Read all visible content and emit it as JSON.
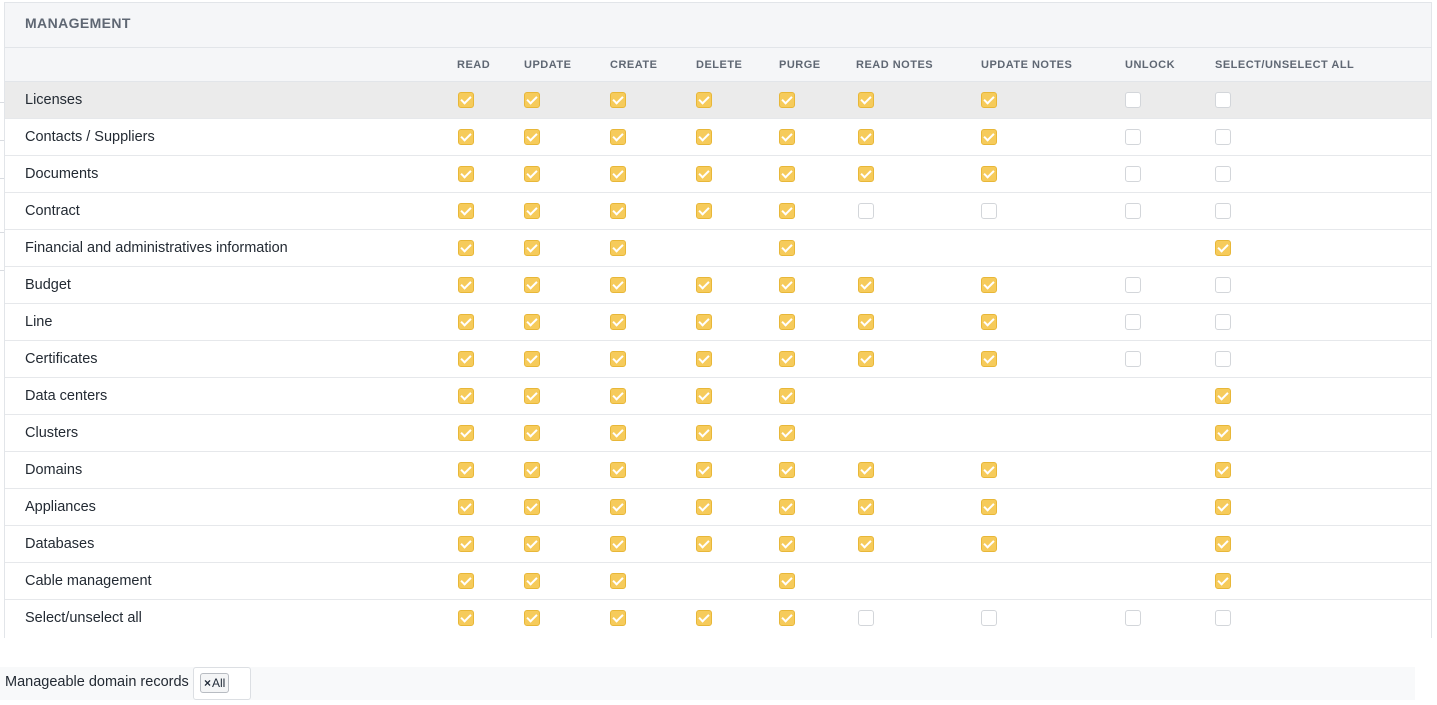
{
  "section_title": "MANAGEMENT",
  "columns": [
    "READ",
    "UPDATE",
    "CREATE",
    "DELETE",
    "PURGE",
    "READ NOTES",
    "UPDATE NOTES",
    "UNLOCK",
    "SELECT/UNSELECT ALL"
  ],
  "rows": [
    {
      "label": "Licenses",
      "cells": [
        1,
        1,
        1,
        1,
        1,
        1,
        1,
        0,
        0
      ]
    },
    {
      "label": "Contacts / Suppliers",
      "cells": [
        1,
        1,
        1,
        1,
        1,
        1,
        1,
        0,
        0
      ]
    },
    {
      "label": "Documents",
      "cells": [
        1,
        1,
        1,
        1,
        1,
        1,
        1,
        0,
        0
      ]
    },
    {
      "label": "Contract",
      "cells": [
        1,
        1,
        1,
        1,
        1,
        0,
        0,
        0,
        0
      ]
    },
    {
      "label": "Financial and administratives information",
      "cells": [
        1,
        1,
        1,
        null,
        1,
        null,
        null,
        null,
        1
      ]
    },
    {
      "label": "Budget",
      "cells": [
        1,
        1,
        1,
        1,
        1,
        1,
        1,
        0,
        0
      ]
    },
    {
      "label": "Line",
      "cells": [
        1,
        1,
        1,
        1,
        1,
        1,
        1,
        0,
        0
      ]
    },
    {
      "label": "Certificates",
      "cells": [
        1,
        1,
        1,
        1,
        1,
        1,
        1,
        0,
        0
      ]
    },
    {
      "label": "Data centers",
      "cells": [
        1,
        1,
        1,
        1,
        1,
        null,
        null,
        null,
        1
      ]
    },
    {
      "label": "Clusters",
      "cells": [
        1,
        1,
        1,
        1,
        1,
        null,
        null,
        null,
        1
      ]
    },
    {
      "label": "Domains",
      "cells": [
        1,
        1,
        1,
        1,
        1,
        1,
        1,
        null,
        1
      ]
    },
    {
      "label": "Appliances",
      "cells": [
        1,
        1,
        1,
        1,
        1,
        1,
        1,
        null,
        1
      ]
    },
    {
      "label": "Databases",
      "cells": [
        1,
        1,
        1,
        1,
        1,
        1,
        1,
        null,
        1
      ]
    },
    {
      "label": "Cable management",
      "cells": [
        1,
        1,
        1,
        null,
        1,
        null,
        null,
        null,
        1
      ]
    },
    {
      "label": "Select/unselect all",
      "cells": [
        1,
        1,
        1,
        1,
        1,
        0,
        0,
        0,
        0
      ]
    }
  ],
  "footer": {
    "label": "Manageable domain records",
    "chip_remove_icon": "×",
    "chip_value": "All"
  },
  "colors": {
    "checked": "#f6cb5b",
    "unchecked_border": "#d3d6da"
  }
}
